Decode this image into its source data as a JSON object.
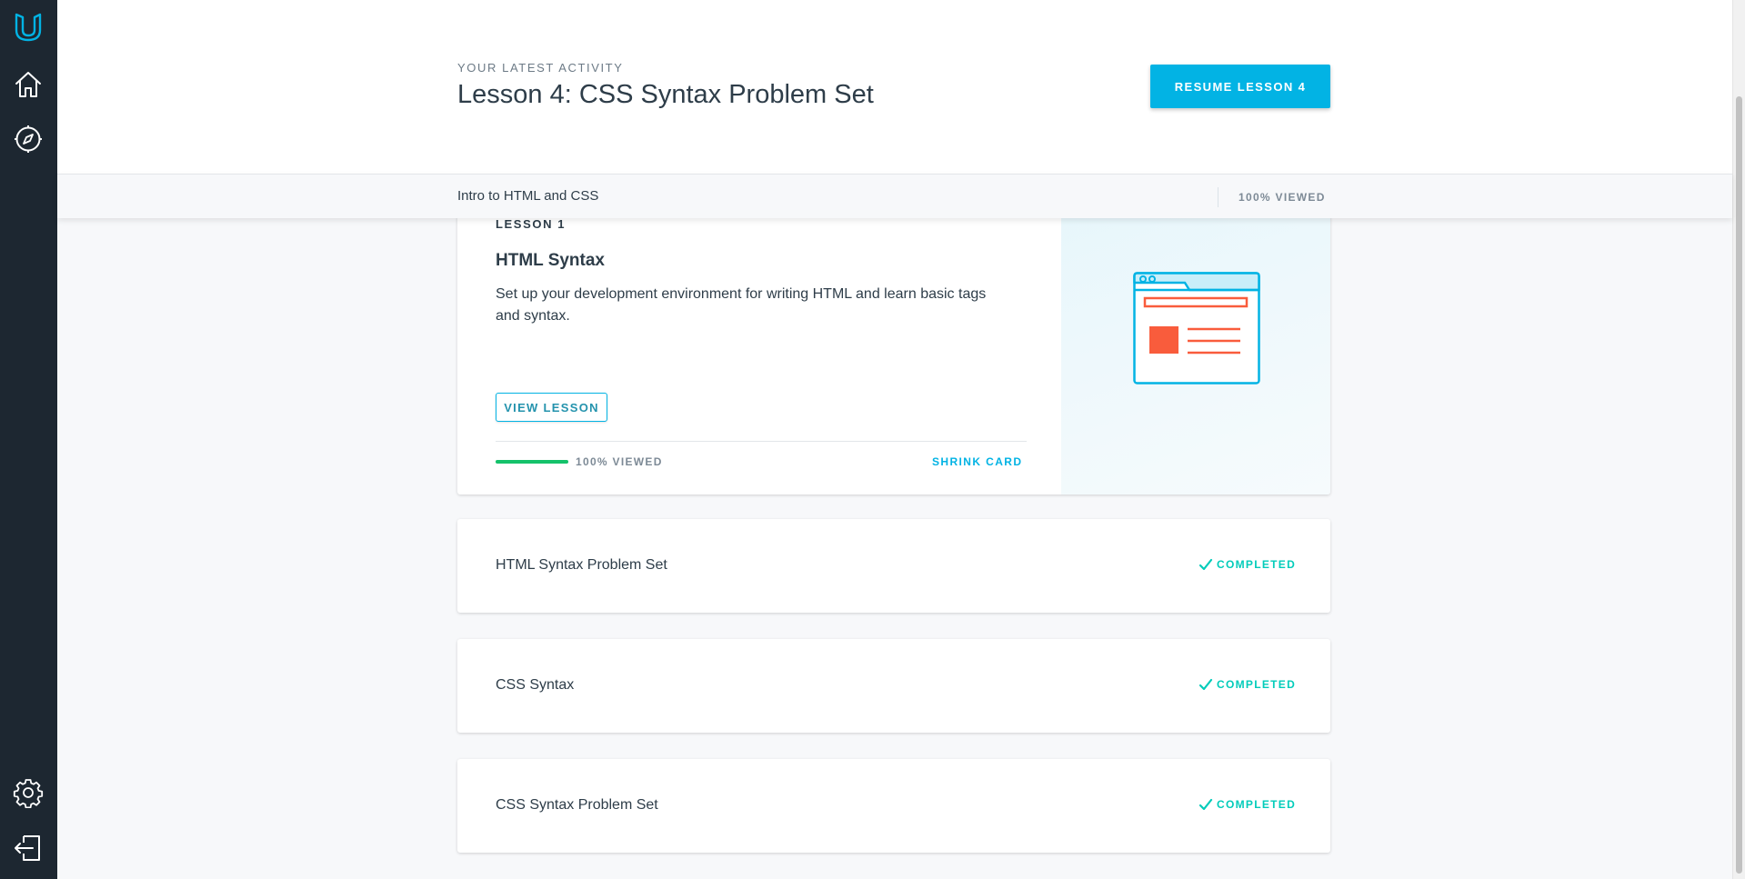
{
  "sidebar": {
    "icons": [
      "udacity-logo-icon",
      "home-icon",
      "compass-icon",
      "gear-icon",
      "logout-icon"
    ]
  },
  "header": {
    "eyebrow": "YOUR LATEST ACTIVITY",
    "title": "Lesson 4: CSS Syntax Problem Set",
    "resume_label": "RESUME LESSON 4"
  },
  "course_bar": {
    "course_name": "Intro to HTML and CSS",
    "progress_text": "100% VIEWED"
  },
  "lesson_card": {
    "eyebrow": "LESSON 1",
    "title": "HTML Syntax",
    "description": "Set up your development environment for writing HTML and learn basic tags and syntax.",
    "view_label": "VIEW LESSON",
    "progress_text": "100% VIEWED",
    "progress_fraction": 1.0,
    "shrink_label": "SHRINK CARD",
    "illustration_icon": "browser-window-icon"
  },
  "concepts": [
    {
      "title": "HTML Syntax Problem Set",
      "status": "COMPLETED"
    },
    {
      "title": "CSS Syntax",
      "status": "COMPLETED"
    },
    {
      "title": "CSS Syntax Problem Set",
      "status": "COMPLETED"
    }
  ],
  "colors": {
    "sidebar_bg": "#1d2731",
    "accent": "#02b3e4",
    "completed": "#02ccba",
    "progress_fill": "#15c26b",
    "illustration_red": "#f95c3c"
  }
}
